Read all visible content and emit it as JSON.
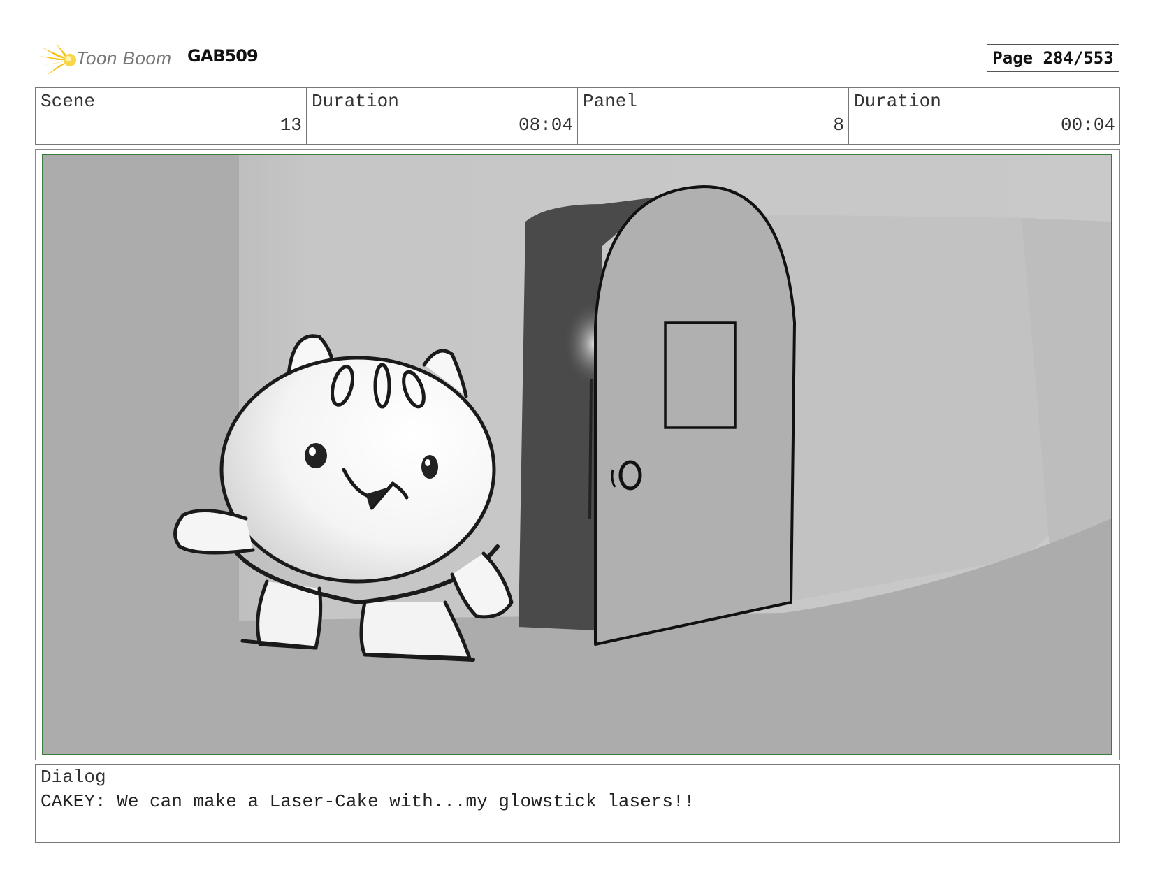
{
  "header": {
    "logo_text": "Toon Boom",
    "project_code": "GAB509",
    "page_label": "Page 284/553"
  },
  "info": {
    "scene_label": "Scene",
    "scene_value": "13",
    "scene_duration_label": "Duration",
    "scene_duration_value": "08:04",
    "panel_label": "Panel",
    "panel_value": "8",
    "panel_duration_label": "Duration",
    "panel_duration_value": "00:04"
  },
  "dialog": {
    "label": "Dialog",
    "text": "CAKEY: We can make a Laser-Cake with...my glowstick lasers!!"
  },
  "colors": {
    "frame_green": "#3a7d3a",
    "logo_yellow": "#f5c518"
  }
}
